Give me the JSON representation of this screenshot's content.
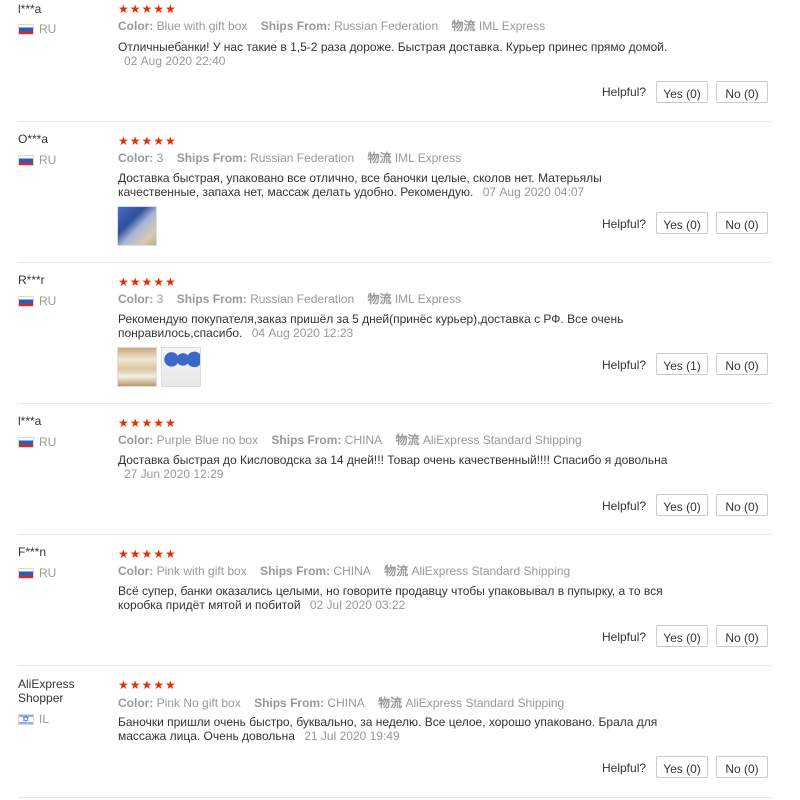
{
  "labels": {
    "color": "Color:",
    "ships_from": "Ships From:",
    "logistics": "物流",
    "helpful": "Helpful?"
  },
  "reviews": [
    {
      "user": "l***a",
      "country": "RU",
      "flag": "ru-flag-icon",
      "stars": "★★★★★",
      "rating": 5,
      "color": "Blue with gift box",
      "ships_from": "Russian Federation",
      "logistics": "IML Express",
      "text": "Отличныебанки! У нас такие в 1,5-2 раза дороже. Быстрая доставка. Курьер принес прямо домой.",
      "date": "02 Aug 2020 22:40",
      "yes": "Yes (0)",
      "no": "No (0)"
    },
    {
      "user": "O***a",
      "country": "RU",
      "flag": "ru-flag-icon",
      "stars": "★★★★★",
      "rating": 5,
      "color": "3",
      "ships_from": "Russian Federation",
      "logistics": "IML Express",
      "text": "Доставка быстрая, упаковано все отлично, все баночки целые, сколов нет. Матерьялы качественные, запаха нет, массаж делать удобно. Рекомендую.",
      "date": "07 Aug 2020 04:07",
      "yes": "Yes (0)",
      "no": "No (0)"
    },
    {
      "user": "R***r",
      "country": "RU",
      "flag": "ru-flag-icon",
      "stars": "★★★★★",
      "rating": 5,
      "color": "3",
      "ships_from": "Russian Federation",
      "logistics": "IML Express",
      "text": "Рекомендую покупателя,заказ пришёл за 5 дней(принёс курьер),доставка с РФ. Все очень понравилось,спасибо.",
      "date": "04 Aug 2020 12:23",
      "yes": "Yes (1)",
      "no": "No (0)"
    },
    {
      "user": "l***a",
      "country": "RU",
      "flag": "ru-flag-icon",
      "stars": "★★★★★",
      "rating": 5,
      "color": "Purple Blue no box",
      "ships_from": "CHINA",
      "logistics": "AliExpress Standard Shipping",
      "text": "Доставка быстрая до Кисловодска за 14 дней!!! Товар очень качественный!!!! Спасибо я довольна",
      "date": "27 Jun 2020 12:29",
      "yes": "Yes (0)",
      "no": "No (0)"
    },
    {
      "user": "F***n",
      "country": "RU",
      "flag": "ru-flag-icon",
      "stars": "★★★★★",
      "rating": 5,
      "color": "Pink with gift box",
      "ships_from": "CHINA",
      "logistics": "AliExpress Standard Shipping",
      "text": "Всё супер, банки оказались целыми, но говорите продавцу чтобы упаковывал в пупырку, а то вся коробка придёт мятой и побитой",
      "date": "02 Jul 2020 03:22",
      "yes": "Yes (0)",
      "no": "No (0)"
    },
    {
      "user": "AliExpress Shopper",
      "country": "IL",
      "flag": "il-flag-icon",
      "stars": "★★★★★",
      "rating": 5,
      "color": "Pink No gift box",
      "ships_from": "CHINA",
      "logistics": "AliExpress Standard Shipping",
      "text": "Баночки пришли очень быстро, буквально, за неделю. Все целое, хорошо упаковано. Брала для массажа лица. Очень довольна",
      "date": "21 Jul 2020 19:49",
      "yes": "Yes (0)",
      "no": "No (0)"
    }
  ]
}
